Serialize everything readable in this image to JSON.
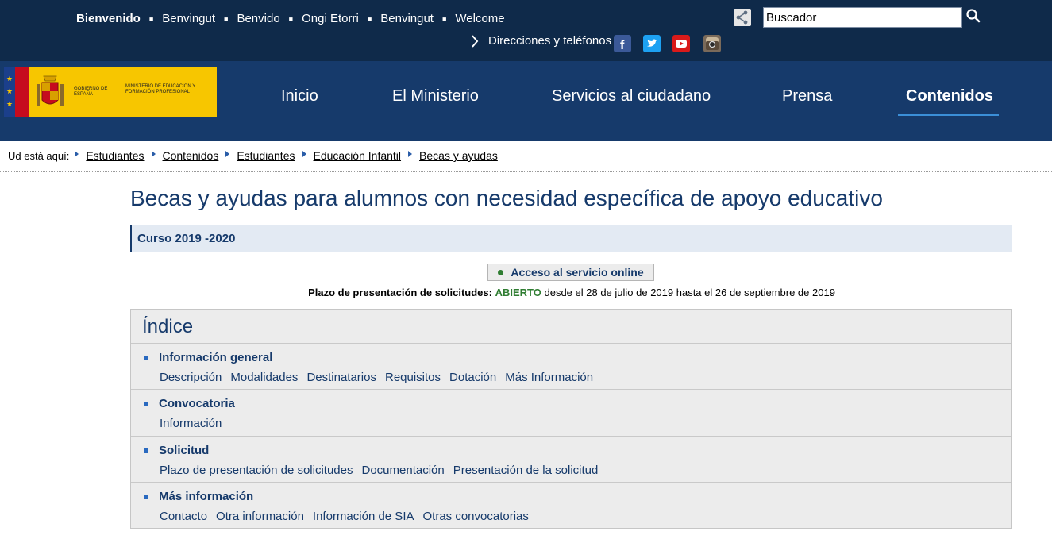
{
  "header": {
    "languages": [
      "Bienvenido",
      "Benvingut",
      "Benvido",
      "Ongi Etorri",
      "Benvingut",
      "Welcome"
    ],
    "search_placeholder": "Buscador",
    "directions_link": "Direcciones y teléfonos",
    "social": [
      "facebook-icon",
      "twitter-icon",
      "youtube-icon",
      "instagram-icon"
    ]
  },
  "logo": {
    "gov_text": "GOBIERNO DE ESPAÑA",
    "ministry_text": "MINISTERIO DE EDUCACIÓN Y FORMACIÓN PROFESIONAL"
  },
  "nav": {
    "items": [
      "Inicio",
      "El Ministerio",
      "Servicios al ciudadano",
      "Prensa",
      "Contenidos"
    ],
    "active": "Contenidos"
  },
  "breadcrumb": {
    "label": "Ud está aquí:",
    "items": [
      "Estudiantes",
      "Contenidos",
      "Estudiantes",
      "Educación Infantil",
      "Becas y ayudas"
    ]
  },
  "main": {
    "title": "Becas y ayudas para alumnos con necesidad específica de apoyo educativo",
    "course": "Curso 2019 -2020",
    "online_button": "Acceso al servicio online",
    "deadline_label": "Plazo de presentación de solicitudes:",
    "deadline_status": "ABIERTO",
    "deadline_dates": "desde el 28 de julio de 2019 hasta el 26 de septiembre de 2019"
  },
  "index": {
    "title": "Índice",
    "sections": [
      {
        "title": "Información general",
        "links": [
          "Descripción",
          "Modalidades",
          "Destinatarios",
          "Requisitos",
          "Dotación",
          "Más Información"
        ]
      },
      {
        "title": "Convocatoria",
        "links": [
          "Información"
        ]
      },
      {
        "title": "Solicitud",
        "links": [
          "Plazo de presentación de solicitudes",
          "Documentación",
          "Presentación de la solicitud"
        ]
      },
      {
        "title": "Más información",
        "links": [
          "Contacto",
          "Otra información",
          "Información de SIA",
          "Otras convocatorias"
        ]
      }
    ]
  },
  "colors": {
    "topbar": "#0f2a4a",
    "mainbar": "#163a6b",
    "accent": "#3b8fd8",
    "status_open": "#2f7d32"
  }
}
